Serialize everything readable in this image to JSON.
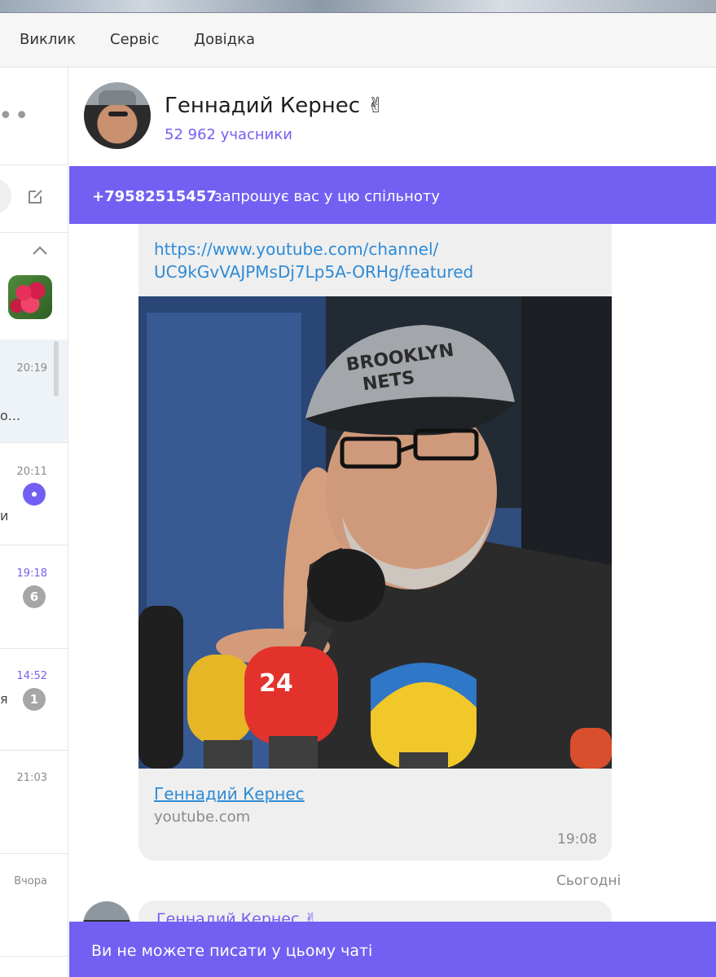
{
  "menu": {
    "items": [
      "Виклик",
      "Сервіс",
      "Довідка"
    ]
  },
  "sidebar": {
    "more_glyph": "••",
    "chats": [
      {
        "time": "20:19",
        "badge": "",
        "frag": "о..."
      },
      {
        "time": "20:11",
        "badge": "",
        "frag": "и"
      },
      {
        "time": "19:18",
        "badge": "6",
        "frag": ""
      },
      {
        "time": "14:52",
        "badge": "1",
        "frag": "я"
      },
      {
        "time": "21:03",
        "badge": "",
        "frag": ""
      },
      {
        "time": "Вчора",
        "badge": "",
        "frag": ""
      }
    ]
  },
  "chat": {
    "title": "Геннадий Кернес ✌",
    "members": "52 962 учасники"
  },
  "invite": {
    "phone": "+79582515457",
    "text": "запрошує вас у цю спільноту"
  },
  "message": {
    "link_line1": "https://www.youtube.com/channel/",
    "link_line2": "UC9kGvVAJPMsDj7Lp5A-ORHg/featured",
    "preview_title": "Геннадий Кернес",
    "preview_domain": "youtube.com",
    "time": "19:08"
  },
  "photo": {
    "cap_text_1": "BROOKLYN",
    "cap_text_2": "NETS",
    "mic_text": "24"
  },
  "date_separator": "Сьогодні",
  "next_message": {
    "sender": "Геннадий Кернес ✌"
  },
  "footer": {
    "blocked": "Ви не можете писати у цьому чаті"
  },
  "colors": {
    "accent": "#7360f2",
    "link": "#2e8bd6"
  }
}
